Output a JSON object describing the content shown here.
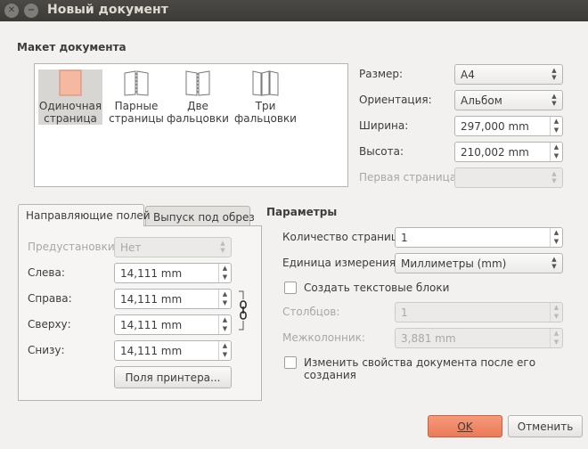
{
  "window": {
    "title": "Новый документ"
  },
  "layout": {
    "section_title": "Макет документа",
    "options": [
      {
        "line1": "Одиночная",
        "line2": "страница",
        "icon": "single-page-icon"
      },
      {
        "line1": "Парные",
        "line2": "страницы",
        "icon": "facing-pages-icon"
      },
      {
        "line1": "Две",
        "line2": "фальцовки",
        "icon": "two-fold-icon"
      },
      {
        "line1": "Три",
        "line2": "фальцовки",
        "icon": "three-fold-icon"
      }
    ],
    "selected": "Одиночная страница"
  },
  "page_props": {
    "size_label": "Размер:",
    "size_value": "A4",
    "orientation_label": "Ориентация:",
    "orientation_value": "Альбом",
    "width_label": "Ширина:",
    "width_value": "297,000 mm",
    "height_label": "Высота:",
    "height_value": "210,002 mm",
    "first_page_label": "Первая страница:",
    "first_page_value": ""
  },
  "tabs": {
    "margins_tab": "Направляющие полей",
    "bleed_tab": "Выпуск под обрез",
    "presets_label": "Предустановки:",
    "presets_value": "Нет",
    "left_label": "Слева:",
    "left_value": "14,111 mm",
    "right_label": "Справа:",
    "right_value": "14,111 mm",
    "top_label": "Сверху:",
    "top_value": "14,111 mm",
    "bottom_label": "Снизу:",
    "bottom_value": "14,111 mm",
    "printer_button": "Поля принтера..."
  },
  "params": {
    "section_title": "Параметры",
    "pages_label": "Количество страниц:",
    "pages_value": "1",
    "unit_label": "Единица измерения:",
    "unit_value": "Миллиметры (mm)",
    "text_frames_label": "Создать текстовые блоки",
    "columns_label": "Столбцов:",
    "columns_value": "1",
    "gap_label": "Межколонник:",
    "gap_value": "3,881 mm",
    "change_props_label": "Изменить свойства документа после его создания"
  },
  "buttons": {
    "ok": "OK",
    "cancel": "Отменить"
  },
  "colors": {
    "accent": "#ec7a57",
    "titlebar": "#3c3b37",
    "background": "#f2f1f0"
  }
}
